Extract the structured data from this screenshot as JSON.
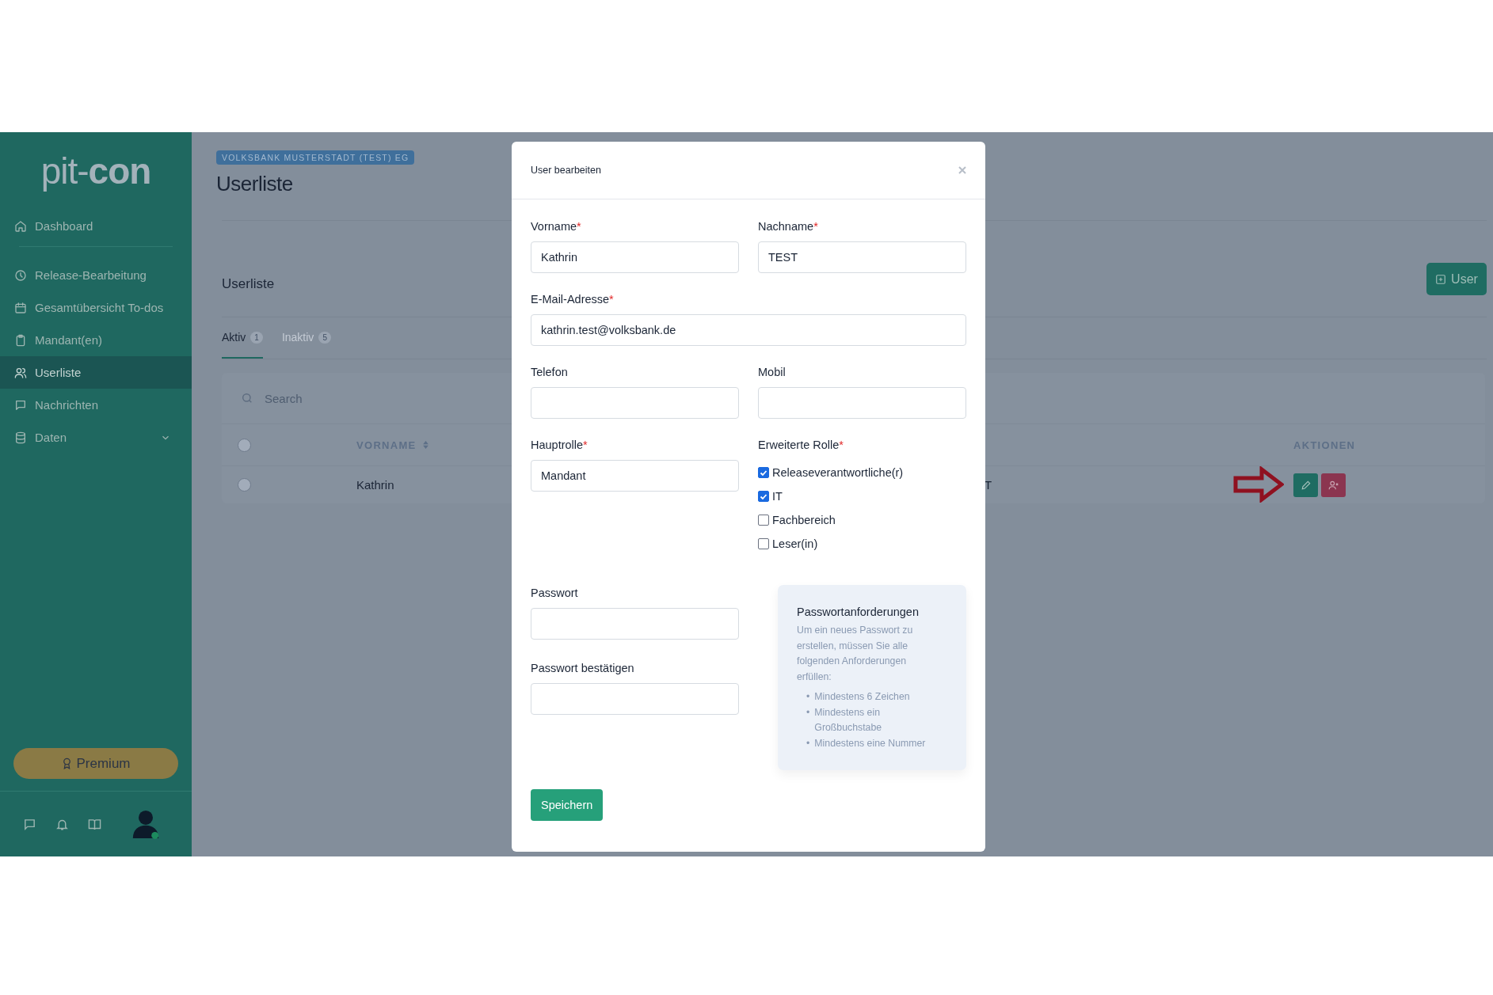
{
  "sidebar": {
    "logo": "pit-**con**",
    "items": [
      {
        "label": "Dashboard",
        "selected": false,
        "expandable": false
      },
      {
        "label": "Release-Bearbeitung",
        "selected": false,
        "expandable": false
      },
      {
        "label": "Gesamtübersicht To-dos",
        "selected": false,
        "expandable": false
      },
      {
        "label": "Mandant(en)",
        "selected": false,
        "expandable": false
      },
      {
        "label": "Userliste",
        "selected": true,
        "expandable": false
      },
      {
        "label": "Nachrichten",
        "selected": false,
        "expandable": false
      },
      {
        "label": "Daten",
        "selected": false,
        "expandable": true
      }
    ],
    "premium_button": "Premium"
  },
  "header": {
    "breadcrumb": "VOLKSBANK MUSTERSTADT (TEST) EG",
    "title": "Userliste"
  },
  "card": {
    "title": "Userliste",
    "add_button": "User",
    "tabs": [
      {
        "label": "Aktiv",
        "count": "1",
        "selected": true
      },
      {
        "label": "Inaktiv",
        "count": "5",
        "selected": false
      }
    ],
    "search": {
      "placeholder": "Search"
    },
    "table": {
      "all_selected": false,
      "columns": [
        {
          "label": "VORNAME",
          "sortable": true
        },
        {
          "label": "AKTIONEN",
          "sortable": false
        }
      ],
      "rows": [
        {
          "selected": false,
          "vorname": "Kathrin",
          "column_3": "T"
        }
      ]
    }
  },
  "modal": {
    "title": "User bearbeiten",
    "rows": [
      [
        {
          "label": "Vorname",
          "required_mark": "*",
          "value": "Kathrin"
        },
        {
          "label": "Nachname",
          "required_mark": "*",
          "value": "TEST"
        }
      ],
      [
        {
          "label": "E-Mail-Adresse",
          "required_mark": "*",
          "value": "kathrin.test@volksbank.de"
        }
      ],
      [
        {
          "label": "Telefon"
        },
        {
          "label": "Mobil"
        }
      ]
    ],
    "main_role": {
      "label": "Hauptrolle",
      "required_mark": "*",
      "value": "Mandant"
    },
    "extended_role": {
      "label": "Erweiterte Rolle",
      "required_mark": "*",
      "options": [
        {
          "label": "Releaseverantwortliche(r)",
          "checked": true
        },
        {
          "label": "IT",
          "checked": true
        },
        {
          "label": "Fachbereich",
          "checked": false
        },
        {
          "label": "Leser(in)",
          "checked": false
        }
      ]
    },
    "password": {
      "label": "Passwort"
    },
    "password_confirm": {
      "label": "Passwort bestätigen"
    },
    "requirements": {
      "title": "Passwortanforderungen",
      "intro": "Um ein neues Passwort zu erstellen, müssen Sie alle folgenden Anforderungen erfüllen:",
      "bullet": "•",
      "items": [
        "Mindestens 6 Zeichen",
        "Mindestens ein Großbuchstabe",
        "Mindestens eine Nummer"
      ]
    },
    "save_button": "Speichern"
  }
}
